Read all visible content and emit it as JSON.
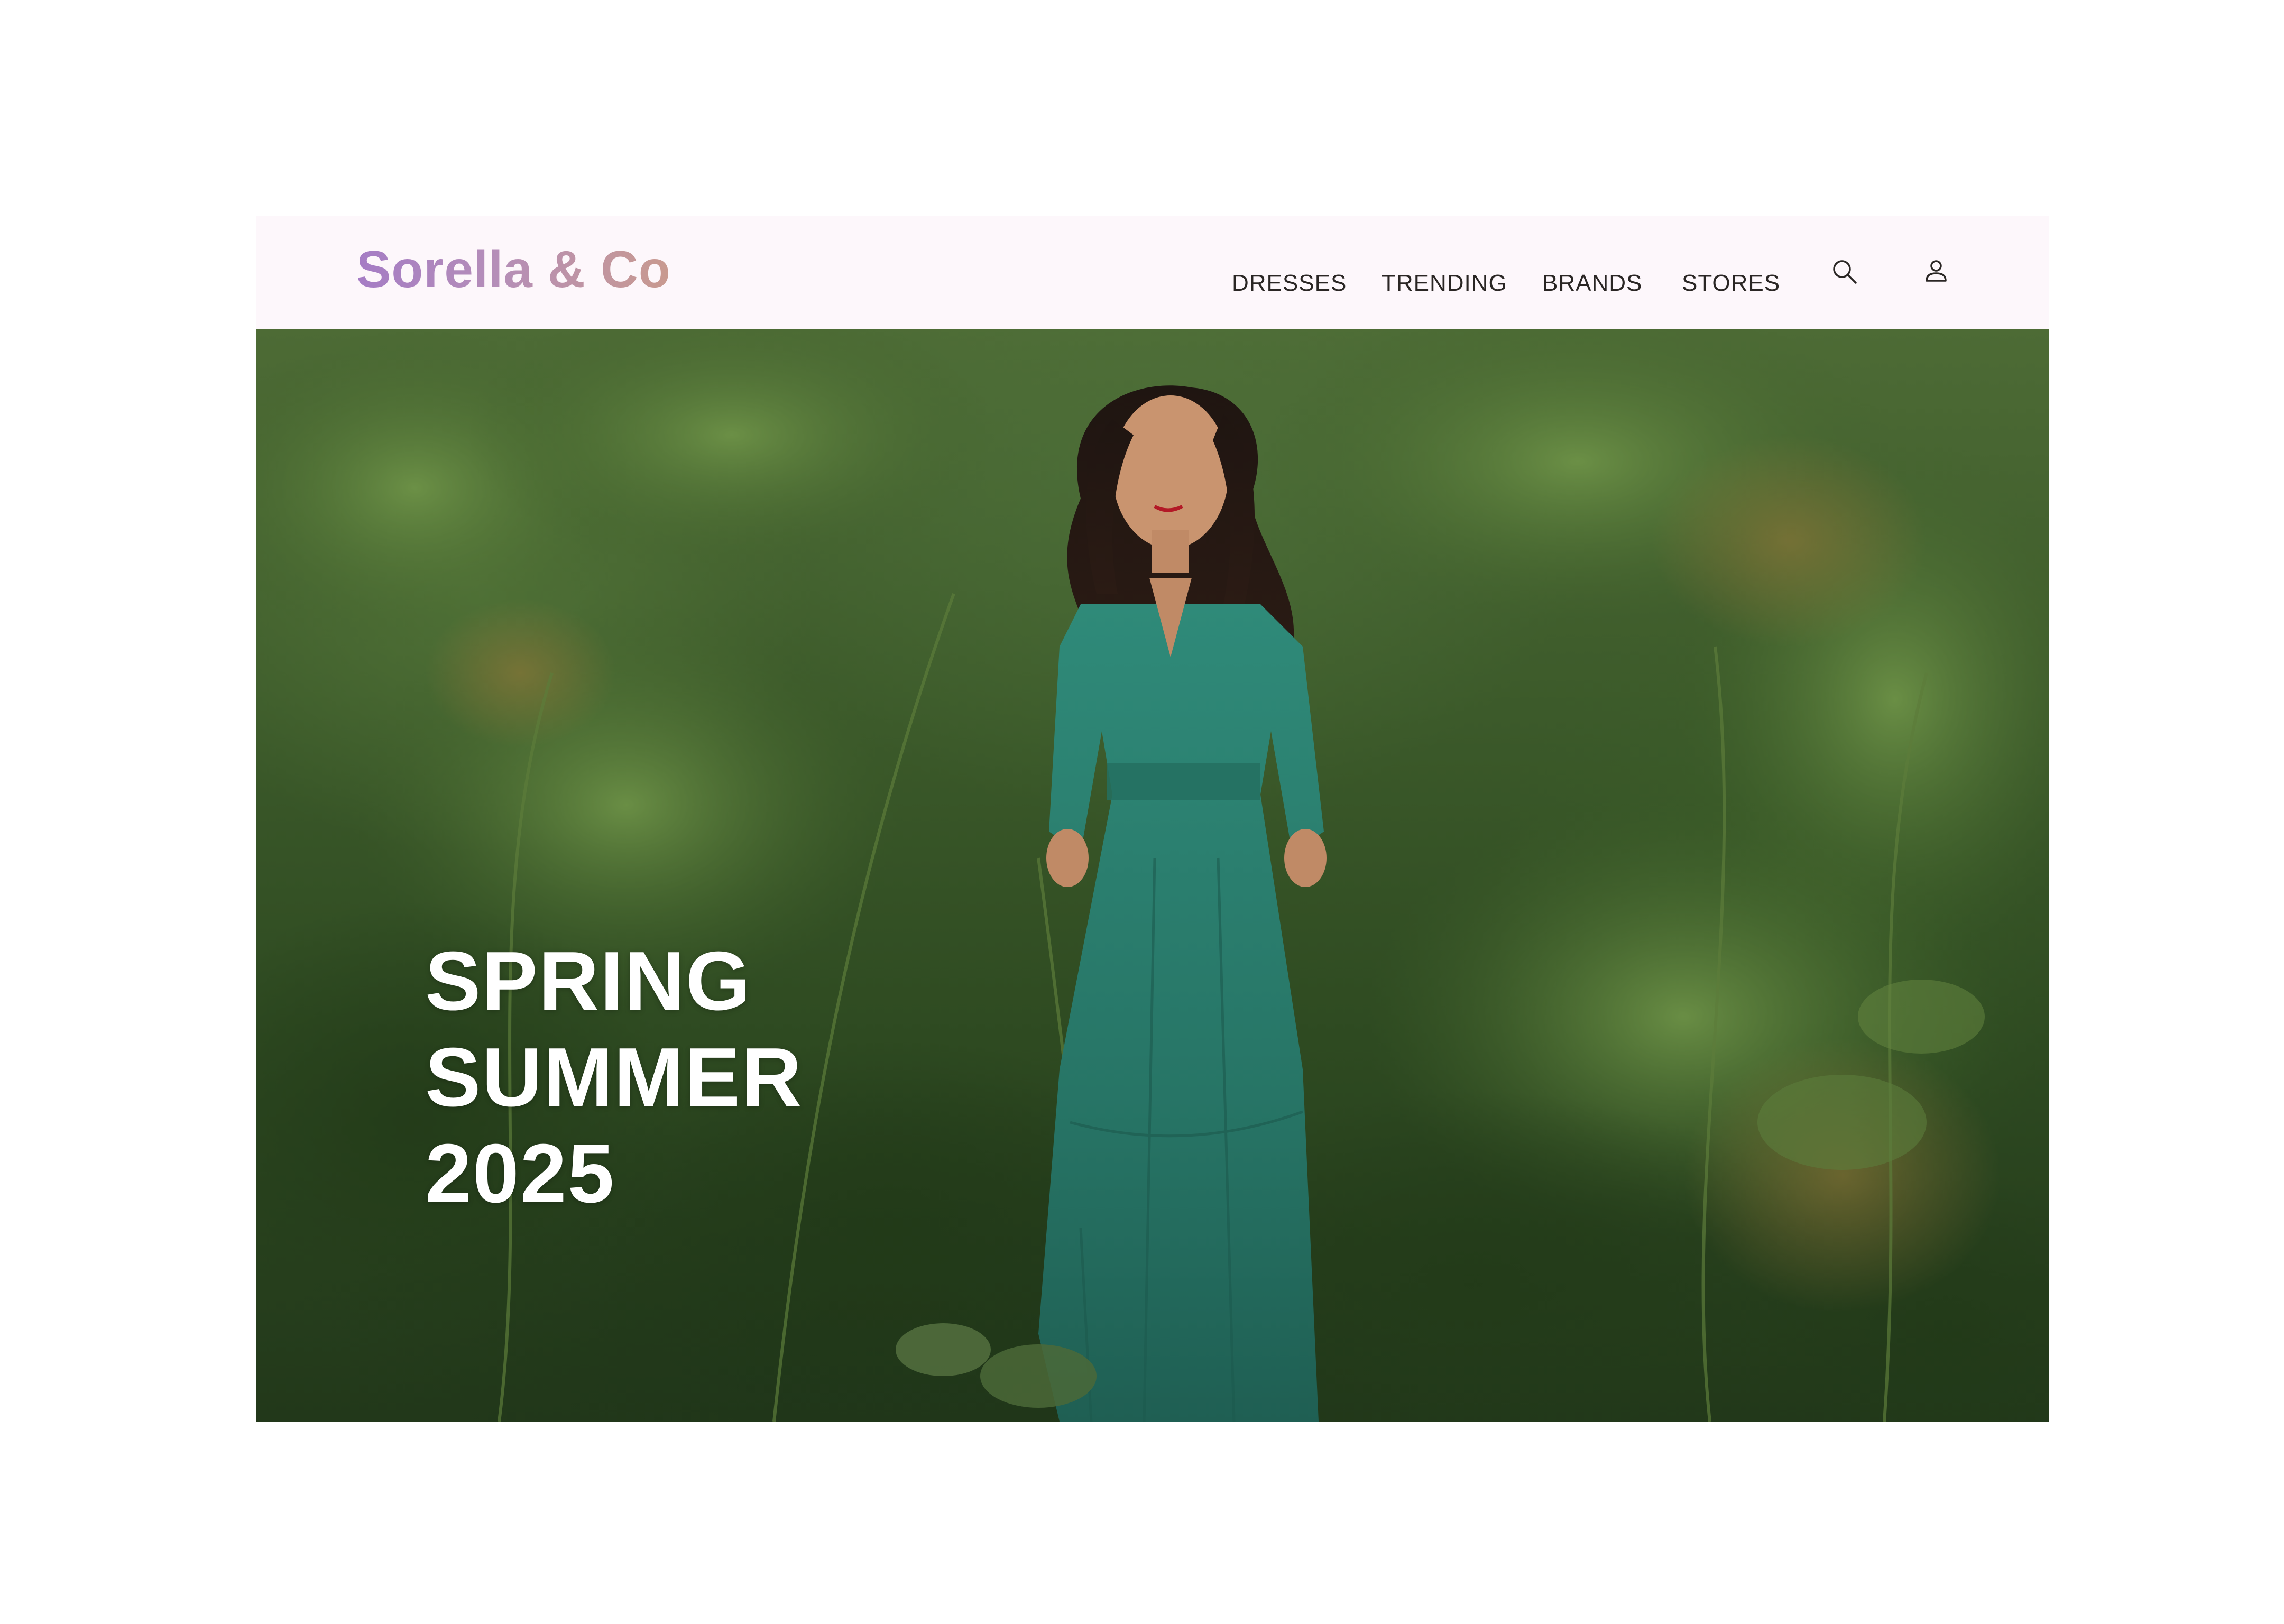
{
  "brand": {
    "name": "Sorella & Co"
  },
  "nav": {
    "items": [
      {
        "label": "DRESSES"
      },
      {
        "label": "TRENDING"
      },
      {
        "label": "BRANDS"
      },
      {
        "label": "STORES"
      }
    ],
    "icons": [
      "search-icon",
      "user-icon"
    ]
  },
  "hero": {
    "title_lines": [
      "SPRING",
      "SUMMER",
      "2025"
    ],
    "image": "woman-in-green-dress-in-garden"
  },
  "colors": {
    "header_bg": "#fdf7fb",
    "logo_gradient_start": "#a57cc5",
    "logo_gradient_end": "#c99a8f",
    "nav_text": "#2a2624",
    "hero_text": "#ffffff",
    "dress": "#2e8a78"
  }
}
